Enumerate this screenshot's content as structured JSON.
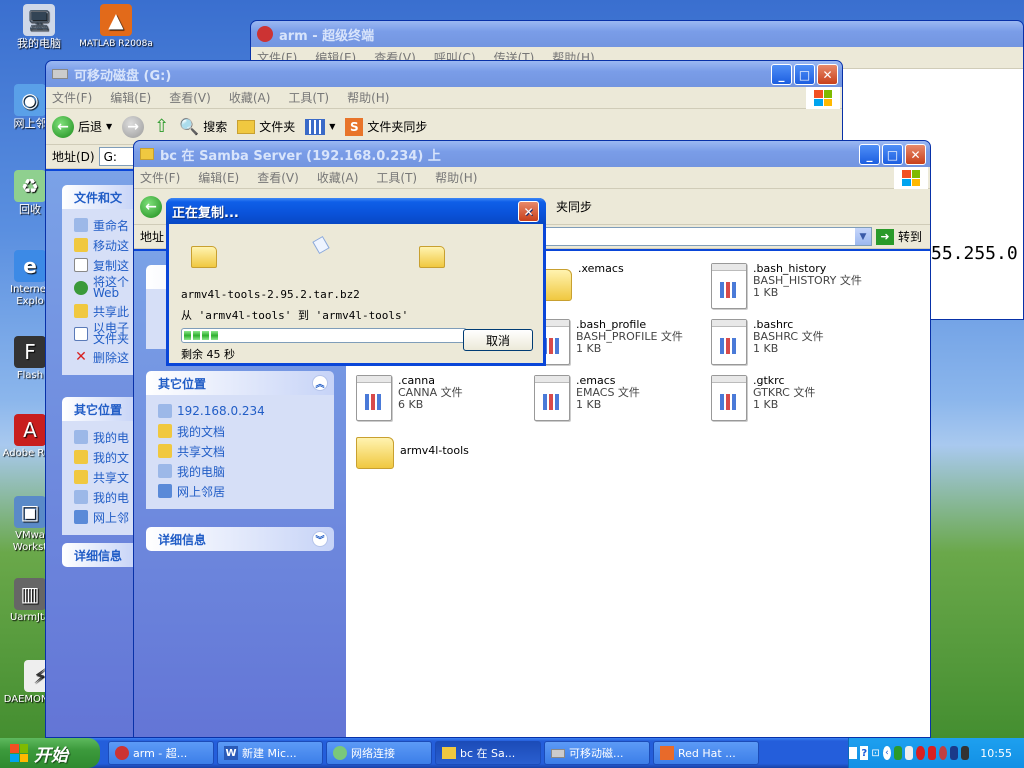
{
  "desktop_icons": [
    {
      "label": "我的电脑",
      "icon": "computer-icon"
    },
    {
      "label": "MATLAB R2008a",
      "icon": "matlab-icon"
    },
    {
      "label": "网上邻",
      "icon": "network-icon"
    },
    {
      "label": "回收",
      "icon": "recycle-bin-icon"
    },
    {
      "label": "Internet Explo",
      "icon": "ie-icon"
    },
    {
      "label": "Flash",
      "icon": "flash-icon"
    },
    {
      "label": "Adobe R XI",
      "icon": "adobe-reader-icon"
    },
    {
      "label": "VMwa Workst",
      "icon": "vmware-icon"
    },
    {
      "label": "UarmJta",
      "icon": "uarmjtag-icon"
    },
    {
      "label": "DAEMON Tools",
      "icon": "daemon-tools-icon"
    }
  ],
  "arm_window": {
    "title": "arm - 超级终端",
    "menu": [
      "文件(F)",
      "编辑(E)",
      "查看(V)",
      "呼叫(C)",
      "传送(T)",
      "帮助(H)"
    ],
    "terminal_text": "55.255.0"
  },
  "g_window": {
    "title": "可移动磁盘 (G:)",
    "menu": [
      "文件(F)",
      "编辑(E)",
      "查看(V)",
      "收藏(A)",
      "工具(T)",
      "帮助(H)"
    ],
    "toolbar": {
      "back": "后退",
      "search": "搜索",
      "folders": "文件夹",
      "sync": "文件夹同步"
    },
    "address_label": "地址(D)",
    "address_value": "G:",
    "tasks_title": "文件和文",
    "tasks": [
      "重命名",
      "移动这",
      "复制这",
      "将这个 Web",
      "共享此",
      "以电子 文件夹",
      "删除这"
    ],
    "other_title": "其它位置",
    "other": [
      "我的电",
      "我的文",
      "共享文",
      "我的电",
      "网上邻"
    ],
    "details_title": "详细信息"
  },
  "bc_window": {
    "title": "bc 在 Samba Server (192.168.0.234) 上",
    "menu": [
      "文件(F)",
      "编辑(E)",
      "查看(V)",
      "收藏(A)",
      "工具(T)",
      "帮助(H)"
    ],
    "toolbar_sync": "夹同步",
    "address_label": "地址",
    "go": "转到",
    "other_title": "其它位置",
    "other": [
      "192.168.0.234",
      "我的文档",
      "共享文档",
      "我的电脑",
      "网上邻居"
    ],
    "details_title": "详细信息",
    "files": [
      {
        "name": ".xemacs",
        "type": "",
        "size": "",
        "kind": "folder"
      },
      {
        "name": ".bash_history",
        "type": "BASH_HISTORY 文件",
        "size": "1 KB",
        "kind": "doc"
      },
      {
        "name": ".bash_profile",
        "type": "BASH_PROFILE 文件",
        "size": "1 KB",
        "kind": "doc"
      },
      {
        "name": ".bashrc",
        "type": "BASHRC 文件",
        "size": "1 KB",
        "kind": "doc"
      },
      {
        "name": ".canna",
        "type": "CANNA 文件",
        "size": "6 KB",
        "kind": "doc"
      },
      {
        "name": ".emacs",
        "type": "EMACS 文件",
        "size": "1 KB",
        "kind": "doc"
      },
      {
        "name": ".gtkrc",
        "type": "GTKRC 文件",
        "size": "1 KB",
        "kind": "doc"
      },
      {
        "name": "armv4l-tools",
        "type": "",
        "size": "",
        "kind": "folder"
      }
    ]
  },
  "copy_dialog": {
    "title": "正在复制...",
    "filename": "armv4l-tools-2.95.2.tar.bz2",
    "from_to": "从 'armv4l-tools' 到 'armv4l-tools'",
    "remaining": "剩余 45 秒",
    "progress_fraction": 0.06,
    "cancel": "取消"
  },
  "taskbar": {
    "start": "开始",
    "tasks": [
      {
        "label": "arm - 超...",
        "icon": "hyperterminal-icon"
      },
      {
        "label": "新建 Mic...",
        "icon": "word-icon"
      },
      {
        "label": "网络连接",
        "icon": "network-connections-icon"
      },
      {
        "label": "bc 在 Sa...",
        "icon": "folder-icon"
      },
      {
        "label": "可移动磁...",
        "icon": "drive-icon"
      },
      {
        "label": "Red Hat ...",
        "icon": "vmware-icon"
      }
    ],
    "clock": "10:55"
  }
}
